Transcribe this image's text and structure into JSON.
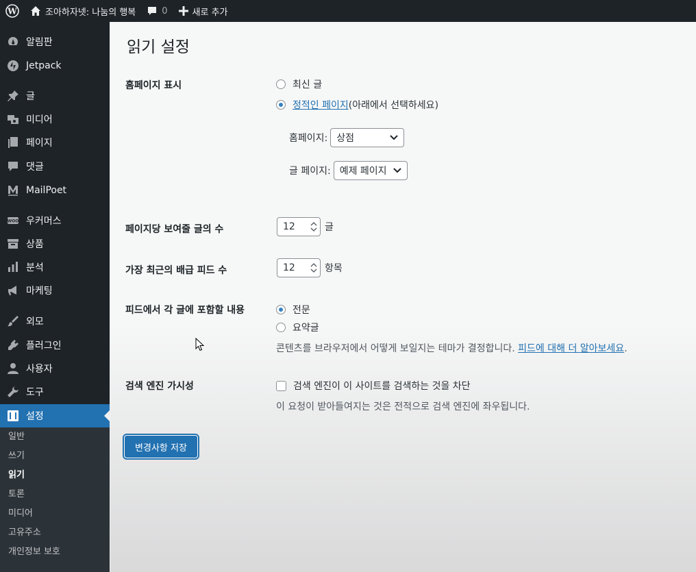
{
  "adminbar": {
    "site_name": "조아하자넷: 나눔의 행복",
    "comments_count": "0",
    "new_label": "새로 추가"
  },
  "sidebar": {
    "items": [
      {
        "label": "알림판",
        "icon": "dashboard-icon"
      },
      {
        "label": "Jetpack",
        "icon": "jetpack-icon"
      },
      {
        "label": "글",
        "icon": "pin-icon"
      },
      {
        "label": "미디어",
        "icon": "media-icon"
      },
      {
        "label": "페이지",
        "icon": "page-icon"
      },
      {
        "label": "댓글",
        "icon": "comment-icon"
      },
      {
        "label": "MailPoet",
        "icon": "mailpoet-icon"
      },
      {
        "label": "우커머스",
        "icon": "woo-icon"
      },
      {
        "label": "상품",
        "icon": "archive-icon"
      },
      {
        "label": "분석",
        "icon": "chart-icon"
      },
      {
        "label": "마케팅",
        "icon": "megaphone-icon"
      },
      {
        "label": "외모",
        "icon": "brush-icon"
      },
      {
        "label": "플러그인",
        "icon": "plugin-icon"
      },
      {
        "label": "사용자",
        "icon": "user-icon"
      },
      {
        "label": "도구",
        "icon": "wrench-icon"
      },
      {
        "label": "설정",
        "icon": "settings-icon"
      }
    ],
    "submenu": [
      "일반",
      "쓰기",
      "읽기",
      "토론",
      "미디어",
      "고유주소",
      "개인정보 보호"
    ]
  },
  "page": {
    "title": "읽기 설정",
    "homepage_display": {
      "label": "홈페이지 표시",
      "option_latest": "최신 글",
      "option_static_link": "정적인 페이지",
      "option_static_suffix": " (아래에서 선택하세요)",
      "homepage_label": "홈페이지:",
      "homepage_value": "상점",
      "posts_page_label": "글 페이지:",
      "posts_page_value": "예제 페이지"
    },
    "posts_per_page": {
      "label": "페이지당 보여줄 글의 수",
      "value": "12",
      "unit": "글"
    },
    "feed_items": {
      "label": "가장 최근의 배급 피드 수",
      "value": "12",
      "unit": "항목"
    },
    "feed_content": {
      "label": "피드에서 각 글에 포함할 내용",
      "option_full": "전문",
      "option_excerpt": "요약글",
      "description": "콘텐츠를 브라우저에서 어떻게 보일지는 테마가 결정합니다. ",
      "description_link": "피드에 대해 더 알아보세요",
      "description_end": "."
    },
    "search_visibility": {
      "label": "검색 엔진 가시성",
      "checkbox_label": "검색 엔진이 이 사이트를 검색하는 것을 차단",
      "description": "이 요청이 받아들여지는 것은 전적으로 검색 엔진에 좌우됩니다."
    },
    "save_button": "변경사항 저장"
  },
  "colors": {
    "accent": "#2271b1",
    "sidebar_bg": "#1d2327"
  }
}
